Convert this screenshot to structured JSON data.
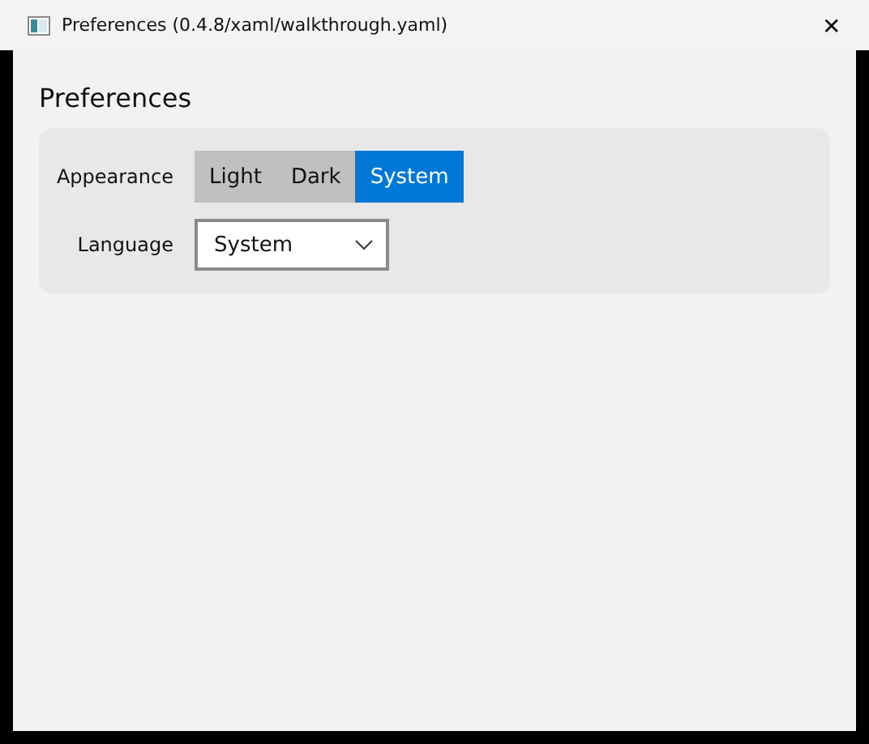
{
  "window": {
    "title": "Preferences (0.4.8/xaml/walkthrough.yaml)",
    "close": "✕"
  },
  "heading": "Preferences",
  "appearance": {
    "label": "Appearance",
    "options": [
      {
        "label": "Light",
        "selected": false
      },
      {
        "label": "Dark",
        "selected": false
      },
      {
        "label": "System",
        "selected": true
      }
    ]
  },
  "language": {
    "label": "Language",
    "value": "System"
  }
}
